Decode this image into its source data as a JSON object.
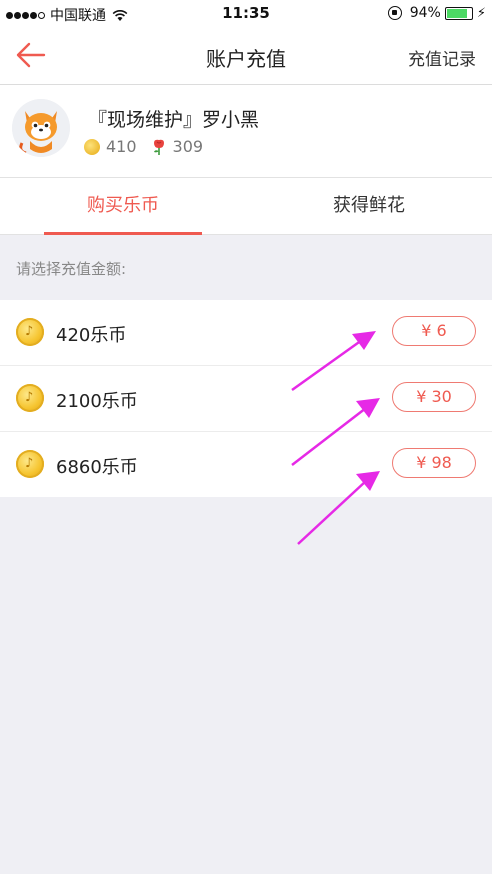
{
  "status_bar": {
    "carrier": "中国联通",
    "time": "11:35",
    "battery": "94%",
    "battery_level": 0.94
  },
  "nav": {
    "title": "账户充值",
    "right_link": "充值记录"
  },
  "profile": {
    "name": "『现场维护』罗小黑",
    "coins": "410",
    "flowers": "309"
  },
  "tabs": [
    {
      "label": "购买乐币",
      "active": true
    },
    {
      "label": "获得鲜花",
      "active": false
    }
  ],
  "section_label": "请选择充值金额:",
  "packages": [
    {
      "label": "420乐币",
      "price": "¥ 6"
    },
    {
      "label": "2100乐币",
      "price": "¥ 30"
    },
    {
      "label": "6860乐币",
      "price": "¥ 98"
    }
  ],
  "colors": {
    "accent": "#ef5a50",
    "annotation_arrow": "#e629e6",
    "coin": "#f6c531"
  }
}
